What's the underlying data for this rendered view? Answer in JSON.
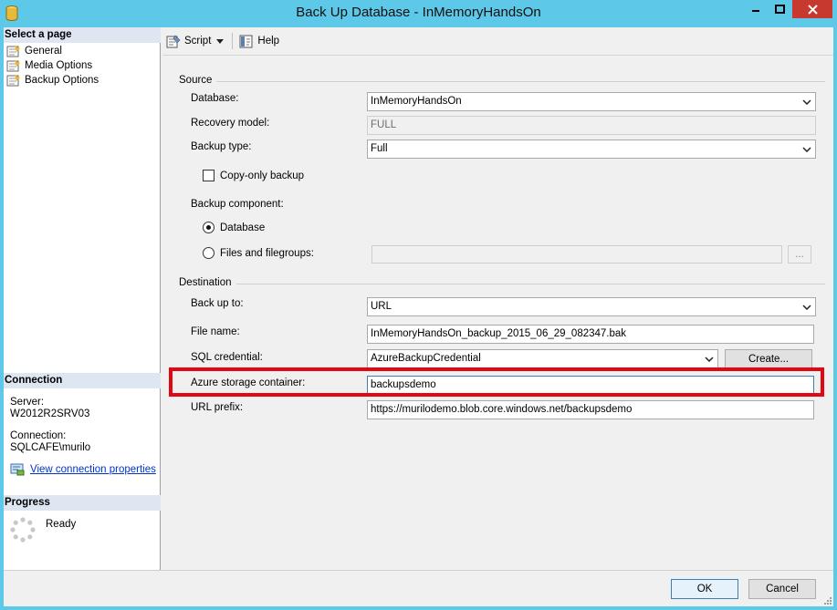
{
  "window": {
    "title": "Back Up Database - InMemoryHandsOn"
  },
  "left_pane": {
    "select_page_header": "Select a page",
    "pages": [
      {
        "label": "General"
      },
      {
        "label": "Media Options"
      },
      {
        "label": "Backup Options"
      }
    ],
    "connection_header": "Connection",
    "server_label": "Server:",
    "server_value": "W2012R2SRV03",
    "connection_label": "Connection:",
    "connection_value": "SQLCAFE\\murilo",
    "view_connection_link": "View connection properties",
    "progress_header": "Progress",
    "progress_status": "Ready"
  },
  "toolbar": {
    "script_label": "Script",
    "help_label": "Help"
  },
  "source": {
    "group_label": "Source",
    "database_label": "Database:",
    "database_value": "InMemoryHandsOn",
    "recovery_label": "Recovery model:",
    "recovery_value": "FULL",
    "backup_type_label": "Backup type:",
    "backup_type_value": "Full",
    "copy_only_label": "Copy-only backup",
    "copy_only_checked": false,
    "component_label": "Backup component:",
    "component_database_label": "Database",
    "component_files_label": "Files and filegroups:",
    "component_selected": "Database",
    "browse_label": "..."
  },
  "destination": {
    "group_label": "Destination",
    "backup_to_label": "Back up to:",
    "backup_to_value": "URL",
    "file_name_label": "File name:",
    "file_name_value": "InMemoryHandsOn_backup_2015_06_29_082347.bak",
    "credential_label": "SQL credential:",
    "credential_value": "AzureBackupCredential",
    "create_label": "Create...",
    "container_label": "Azure storage container:",
    "container_value": "backupsdemo",
    "url_prefix_label": "URL prefix:",
    "url_prefix_value": "https://murilodemo.blob.core.windows.net/backupsdemo"
  },
  "footer": {
    "ok_label": "OK",
    "cancel_label": "Cancel"
  },
  "colors": {
    "titlebar": "#5ec8e8",
    "close_button": "#c7392f",
    "highlight": "#e30613",
    "link": "#0033cc"
  }
}
